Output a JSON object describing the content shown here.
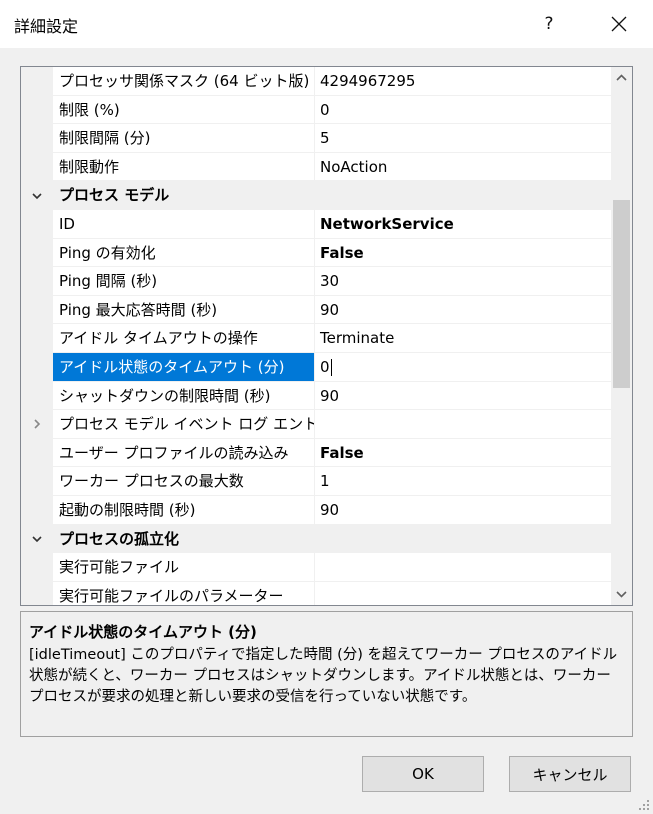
{
  "window": {
    "title": "詳細設定",
    "help_label": "?"
  },
  "grid": {
    "rows": [
      {
        "type": "property",
        "name": "プロセッサ関係マスク (64 ビット版)",
        "value": "4294967295",
        "bold": false
      },
      {
        "type": "property",
        "name": "制限 (%)",
        "value": "0",
        "bold": false
      },
      {
        "type": "property",
        "name": "制限間隔 (分)",
        "value": "5",
        "bold": false
      },
      {
        "type": "property",
        "name": "制限動作",
        "value": "NoAction",
        "bold": false
      },
      {
        "type": "category",
        "name": "プロセス モデル",
        "expanded": true
      },
      {
        "type": "property",
        "name": "ID",
        "value": "NetworkService",
        "bold": true
      },
      {
        "type": "property",
        "name": "Ping の有効化",
        "value": "False",
        "bold": true
      },
      {
        "type": "property",
        "name": "Ping 間隔 (秒)",
        "value": "30",
        "bold": false
      },
      {
        "type": "property",
        "name": "Ping 最大応答時間 (秒)",
        "value": "90",
        "bold": false
      },
      {
        "type": "property",
        "name": "アイドル タイムアウトの操作",
        "value": "Terminate",
        "bold": false
      },
      {
        "type": "property",
        "name": "アイドル状態のタイムアウト (分)",
        "value": "0",
        "bold": false,
        "selected": true
      },
      {
        "type": "property",
        "name": "シャットダウンの制限時間 (秒)",
        "value": "90",
        "bold": false
      },
      {
        "type": "property",
        "name": "プロセス モデル イベント ログ エントリ(",
        "value": "",
        "bold": false,
        "collapsed": true
      },
      {
        "type": "property",
        "name": "ユーザー プロファイルの読み込み",
        "value": "False",
        "bold": true
      },
      {
        "type": "property",
        "name": "ワーカー プロセスの最大数",
        "value": "1",
        "bold": false
      },
      {
        "type": "property",
        "name": "起動の制限時間 (秒)",
        "value": "90",
        "bold": false
      },
      {
        "type": "category",
        "name": "プロセスの孤立化",
        "expanded": true
      },
      {
        "type": "property",
        "name": "実行可能ファイル",
        "value": "",
        "bold": false
      },
      {
        "type": "property",
        "name": "実行可能ファイルのパラメーター",
        "value": "",
        "bold": false
      }
    ]
  },
  "description": {
    "title": "アイドル状態のタイムアウト (分)",
    "text": "[idleTimeout] このプロパティで指定した時間 (分) を超えてワーカー プロセスのアイドル状態が続くと、ワーカー プロセスはシャットダウンします。アイドル状態とは、ワーカー プロセスが要求の処理と新しい要求の受信を行っていない状態です。"
  },
  "buttons": {
    "ok_label": "OK",
    "cancel_label": "キャンセル"
  },
  "colors": {
    "selection": "#0078d7",
    "gutter": "#f0f0f0"
  }
}
